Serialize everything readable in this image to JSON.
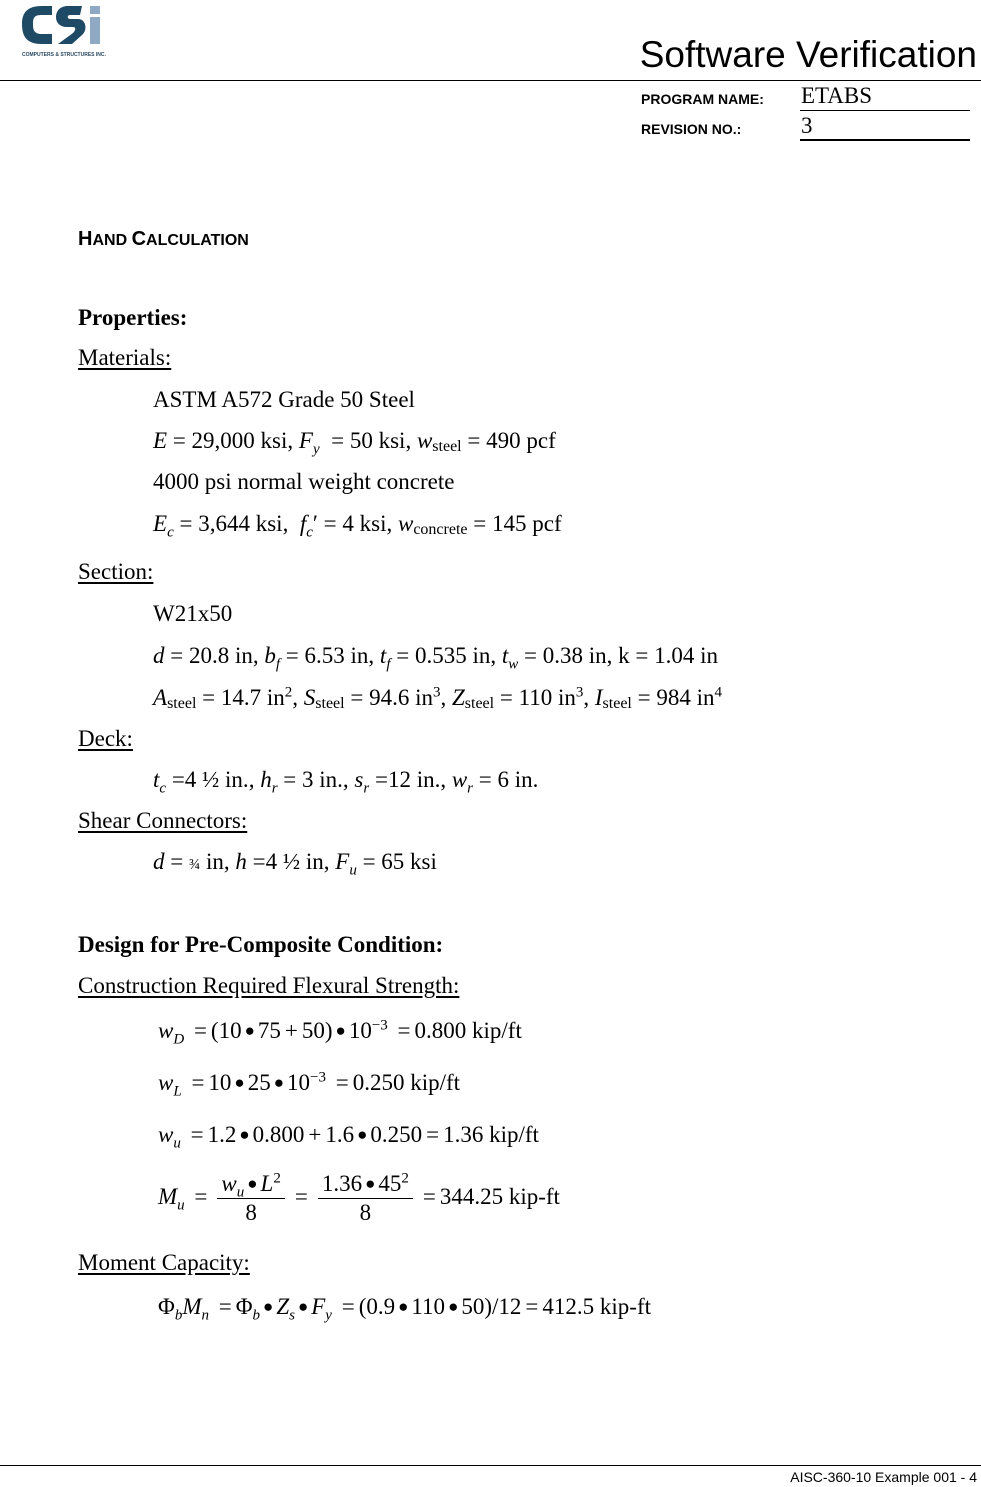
{
  "header": {
    "logo_text": "CSi",
    "logo_tagline": "COMPUTERS & STRUCTURES INC.",
    "title": "Software Verification",
    "program_name_label": "PROGRAM NAME:",
    "program_name_value": "ETABS",
    "revision_label": "REVISION NO.:",
    "revision_value": "3",
    "brand_colors": {
      "dark": "#1f4a66",
      "light": "#8fa9c4"
    }
  },
  "section_heading": {
    "first_H": "H",
    "rest_AND": "AND ",
    "first_C": "C",
    "rest_ALCULATION": "ALCULATION"
  },
  "properties": {
    "title": "Properties:",
    "materials": {
      "label": "Materials:",
      "steel_grade": "ASTM A572 Grade 50 Steel",
      "E": "29,000 ksi",
      "Fy": "50 ksi",
      "w_steel": "490 pcf",
      "concrete_desc": "4000 psi normal weight concrete",
      "Ec": "3,644 ksi",
      "fc": "4 ksi",
      "w_concrete": "145 pcf"
    },
    "section": {
      "label": "Section:",
      "shape": "W21x50",
      "d": "20.8 in",
      "bf": "6.53 in",
      "tf": "0.535 in",
      "tw": "0.38 in",
      "k": "1.04 in",
      "A_steel": "14.7",
      "S_steel": "94.6",
      "Z_steel": "110",
      "I_steel": "984"
    },
    "deck": {
      "label": "Deck:",
      "tc": "4 ½  in.",
      "hr": "3 in.",
      "sr": "12 in.",
      "wr": "6 in."
    },
    "shear_connectors": {
      "label": "Shear Connectors:",
      "d": "¾",
      "h": "4 ½ in",
      "Fu": "65 ksi"
    }
  },
  "precomposite": {
    "title": "Design for Pre-Composite Condition:",
    "flexural_label": "Construction Required Flexural Strength:",
    "wD": {
      "expr_a": "(10",
      "expr_b": "75",
      "expr_c": "+",
      "expr_d": "50)",
      "expr_e": "10",
      "exp": "−3",
      "result": "0.800 kip/ft"
    },
    "wL": {
      "a": "10",
      "b": "25",
      "c": "10",
      "exp": "−3",
      "result": "0.250 kip/ft"
    },
    "wu": {
      "a": "1.2",
      "b": "0.800",
      "c": "1.6",
      "d": "0.250",
      "result": "1.36 kip/ft"
    },
    "Mu": {
      "num2_a": "1.36",
      "num2_b": "45",
      "den": "8",
      "result": "344.25 kip-ft"
    },
    "moment_capacity_label": "Moment Capacity:",
    "phiMn": {
      "a": "(0.9",
      "b": "110",
      "c": "50)",
      "d": "12",
      "result": "412.5 kip-ft"
    }
  },
  "footer": {
    "text": "AISC-360-10 Example 001 - 4"
  }
}
